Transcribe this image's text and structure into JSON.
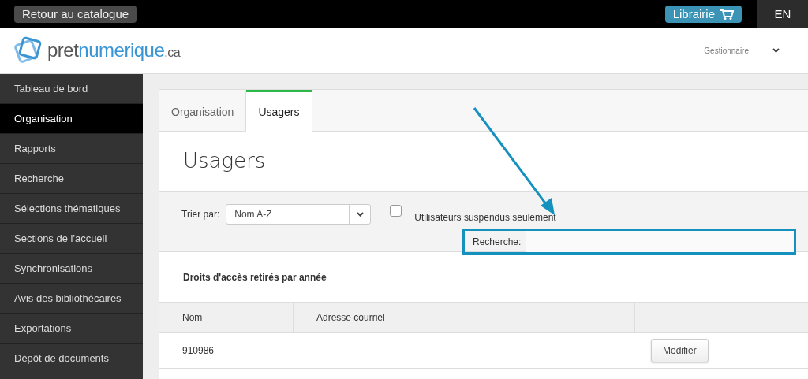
{
  "topbar": {
    "back_button": "Retour au catalogue",
    "store_button": "Librairie",
    "language": "EN",
    "language_highlighted": true
  },
  "header": {
    "logo_dark": "pret",
    "logo_light": "numerique",
    "logo_suffix": ".ca",
    "user_menu": "Gestionnaire"
  },
  "sidebar": {
    "items": [
      {
        "label": "Tableau de bord",
        "selected": false
      },
      {
        "label": "Organisation",
        "selected": true
      },
      {
        "label": "Rapports",
        "selected": false
      },
      {
        "label": "Recherche",
        "selected": false
      },
      {
        "label": "Sélections thématiques",
        "selected": false
      },
      {
        "label": "Sections de l'accueil",
        "selected": false
      },
      {
        "label": "Synchronisations",
        "selected": false
      },
      {
        "label": "Avis des bibliothécaires",
        "selected": false
      },
      {
        "label": "Exportations",
        "selected": false
      },
      {
        "label": "Dépôt de documents",
        "selected": false
      }
    ]
  },
  "tabs": [
    {
      "label": "Organisation",
      "selected": false
    },
    {
      "label": "Usagers",
      "selected": true
    }
  ],
  "page_title": "Usagers",
  "filters": {
    "sort_label": "Trier par:",
    "sort_value": "Nom A-Z",
    "suspended_label": "Utilisateurs suspendus seulement",
    "suspended_checked": false,
    "search_label": "Recherche:",
    "search_highlighted": true
  },
  "section_title": "Droits d'accès retirés par année",
  "table": {
    "columns": [
      "Nom",
      "Adresse courriel"
    ],
    "rows": [
      {
        "name": "910986",
        "action": "Modifier"
      }
    ]
  }
}
